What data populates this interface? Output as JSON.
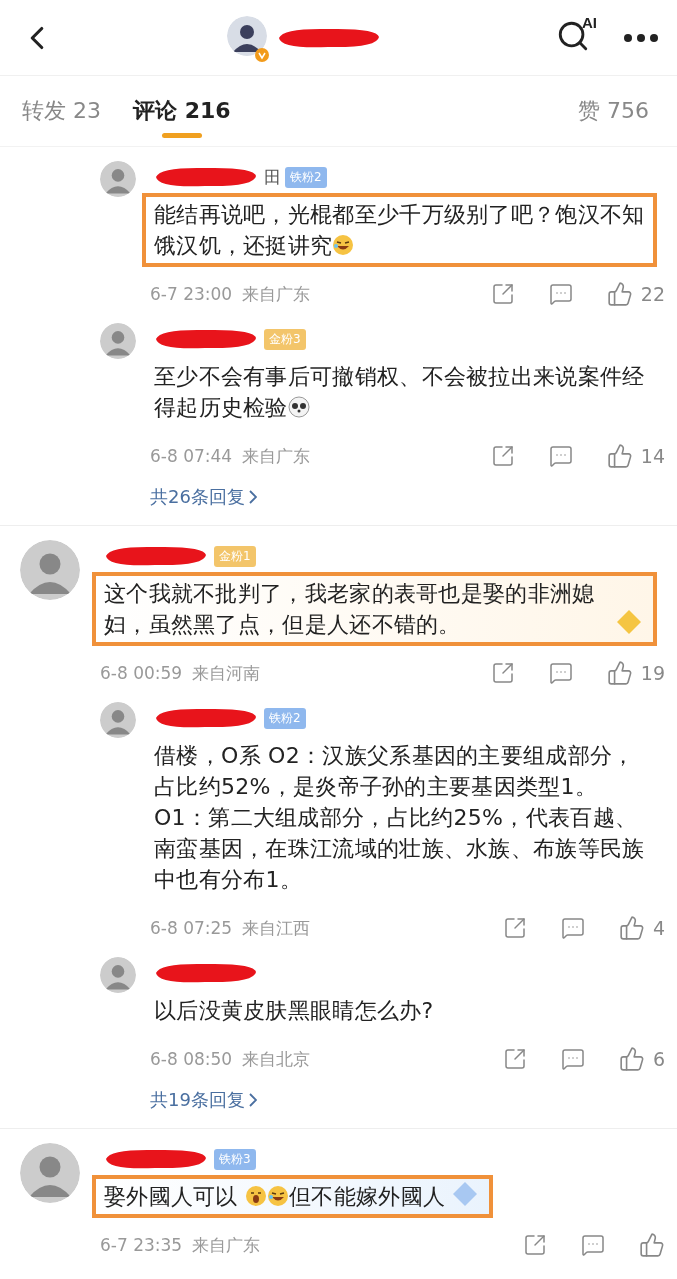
{
  "header": {
    "ai_label": "AI",
    "verified": true,
    "redacted": true
  },
  "tabs": [
    {
      "label": "转发 23",
      "selected": false
    },
    {
      "label": "评论 216",
      "selected": true
    }
  ],
  "likes_tab": "赞 756",
  "threads": [
    {
      "replies": [
        {
          "redacted": true,
          "name_fragment": "田",
          "badge": {
            "label": "铁粉2",
            "kind": "iron"
          },
          "highlighted": true,
          "body": [
            {
              "kind": "text",
              "text": "能结再说吧，光棍都至少千万级别了吧？饱汉不知饿汉饥，还挺讲究"
            },
            {
              "kind": "laughing"
            }
          ],
          "time": "6-7 23:00",
          "location": "来自广东",
          "likes": "22"
        },
        {
          "redacted": true,
          "badge": {
            "label": "金粉3",
            "kind": "gold"
          },
          "highlighted": false,
          "body": [
            {
              "kind": "text",
              "text": "至少不会有事后可撤销权、不会被拉出来说案件经得起历史检验"
            },
            {
              "kind": "panda"
            }
          ],
          "time": "6-8 07:44",
          "location": "来自广东",
          "likes": "14"
        }
      ],
      "more": "共26条回复"
    },
    {
      "comment": {
        "redacted": true,
        "badge": {
          "label": "金粉1",
          "kind": "gold"
        },
        "highlighted": true,
        "decoration": {
          "kind": "gold"
        },
        "body": [
          {
            "kind": "text",
            "text": "这个我就不批判了，我老家的表哥也是娶的非洲媳妇，虽然黑了点，但是人还不错的。"
          }
        ],
        "time": "6-8 00:59",
        "location": "来自河南",
        "likes": "19"
      },
      "replies": [
        {
          "redacted": true,
          "badge": {
            "label": "铁粉2",
            "kind": "iron"
          },
          "highlighted": false,
          "body": [
            {
              "kind": "text",
              "text": "借楼，O系 O2：汉族父系基因的主要组成部分，占比约52%，是炎帝子孙的主要基因类型1。O1：第二大组成部分，占比约25%，代表百越、南蛮基因，在珠江流域的壮族、水族、布族等民族中也有分布1。"
            }
          ],
          "time": "6-8 07:25",
          "location": "来自江西",
          "likes": "4"
        },
        {
          "redacted": true,
          "highlighted": false,
          "body": [
            {
              "kind": "text",
              "text": "以后没黄皮肤黑眼睛怎么办?"
            }
          ],
          "time": "6-8 08:50",
          "location": "来自北京",
          "likes": "6"
        }
      ],
      "more": "共19条回复"
    },
    {
      "comment": {
        "redacted": true,
        "badge": {
          "label": "铁粉3",
          "kind": "iron"
        },
        "highlighted": true,
        "decoration": {
          "kind": "blue"
        },
        "body": [
          {
            "kind": "text",
            "text": "娶外國人可以 "
          },
          {
            "kind": "yawning"
          },
          {
            "kind": "laughing"
          },
          {
            "kind": "text",
            "text": "但不能嫁外國人"
          }
        ],
        "time": "6-7 23:35",
        "location": "来自广东"
      }
    }
  ]
}
